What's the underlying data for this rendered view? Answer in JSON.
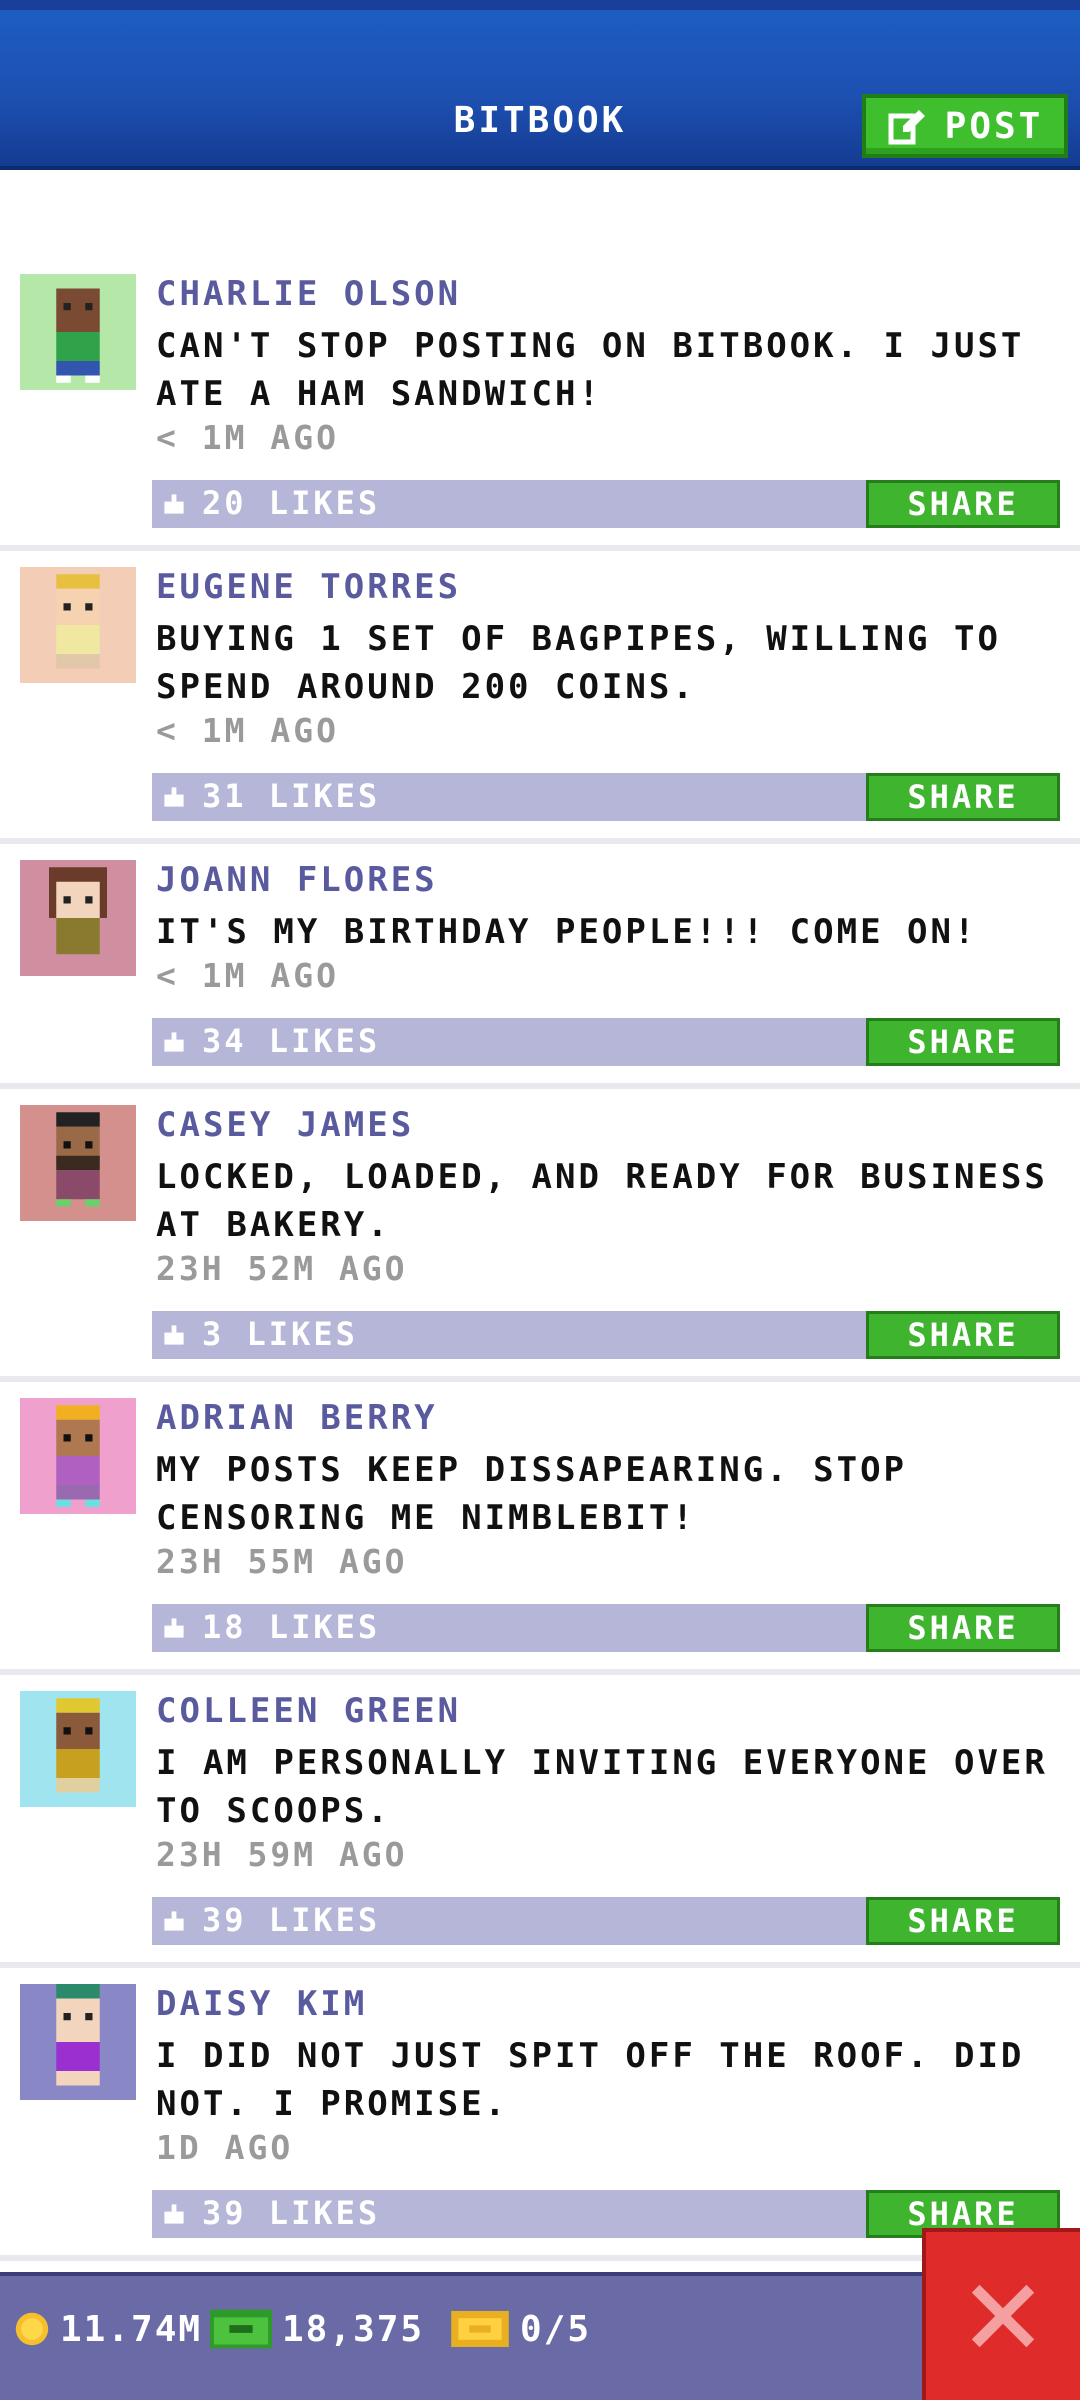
{
  "header": {
    "title": "BITBOOK",
    "post_label": "POST"
  },
  "posts": [
    {
      "author": "CHARLIE OLSON",
      "message": "CAN'T STOP POSTING ON BITBOOK. I JUST ATE A HAM SANDWICH!",
      "time": "< 1M AGO",
      "likes": "20 LIKES",
      "share_label": "SHARE",
      "avatar_bg": "#b5e8a8"
    },
    {
      "author": "EUGENE TORRES",
      "message": "BUYING 1 SET OF BAGPIPES, WILLING TO SPEND AROUND 200 COINS.",
      "time": "< 1M AGO",
      "likes": "31 LIKES",
      "share_label": "SHARE",
      "avatar_bg": "#f3cdb6"
    },
    {
      "author": "JOANN FLORES",
      "message": "IT'S MY BIRTHDAY PEOPLE!!! COME ON!",
      "time": "< 1M AGO",
      "likes": "34 LIKES",
      "share_label": "SHARE",
      "avatar_bg": "#cf8fa0"
    },
    {
      "author": "CASEY JAMES",
      "message": "LOCKED, LOADED, AND READY FOR BUSINESS AT BAKERY.",
      "time": "23H 52M AGO",
      "likes": "3 LIKES",
      "share_label": "SHARE",
      "avatar_bg": "#d4908c"
    },
    {
      "author": "ADRIAN BERRY",
      "message": "MY POSTS KEEP DISSAPEARING. STOP CENSORING ME NIMBLEBIT!",
      "time": "23H 55M AGO",
      "likes": "18 LIKES",
      "share_label": "SHARE",
      "avatar_bg": "#f0a0cc"
    },
    {
      "author": "COLLEEN GREEN",
      "message": "I AM PERSONALLY INVITING EVERYONE OVER TO SCOOPS.",
      "time": "23H 59M AGO",
      "likes": "39 LIKES",
      "share_label": "SHARE",
      "avatar_bg": "#a0e4f0"
    },
    {
      "author": "DAISY KIM",
      "message": "I DID NOT JUST SPIT OFF THE ROOF. DID NOT. I PROMISE.",
      "time": "1D AGO",
      "likes": "39 LIKES",
      "share_label": "SHARE",
      "avatar_bg": "#8a87c6"
    }
  ],
  "bottom_bar": {
    "coins": "11.74M",
    "bux": "18,375",
    "tickets": "0/5"
  },
  "icons": {
    "post": "edit-icon",
    "like": "thumbs-up-icon",
    "coins": "coin-icon",
    "bux": "cash-icon",
    "tickets": "ticket-icon",
    "close": "close-icon"
  },
  "colors": {
    "header_blue": "#1d4fb0",
    "accent_green": "#3fb42f",
    "like_bar": "#b5b6d8",
    "author": "#5a5a9e",
    "close_red": "#e02b2b",
    "bottom_bar": "#6a6aa6"
  }
}
